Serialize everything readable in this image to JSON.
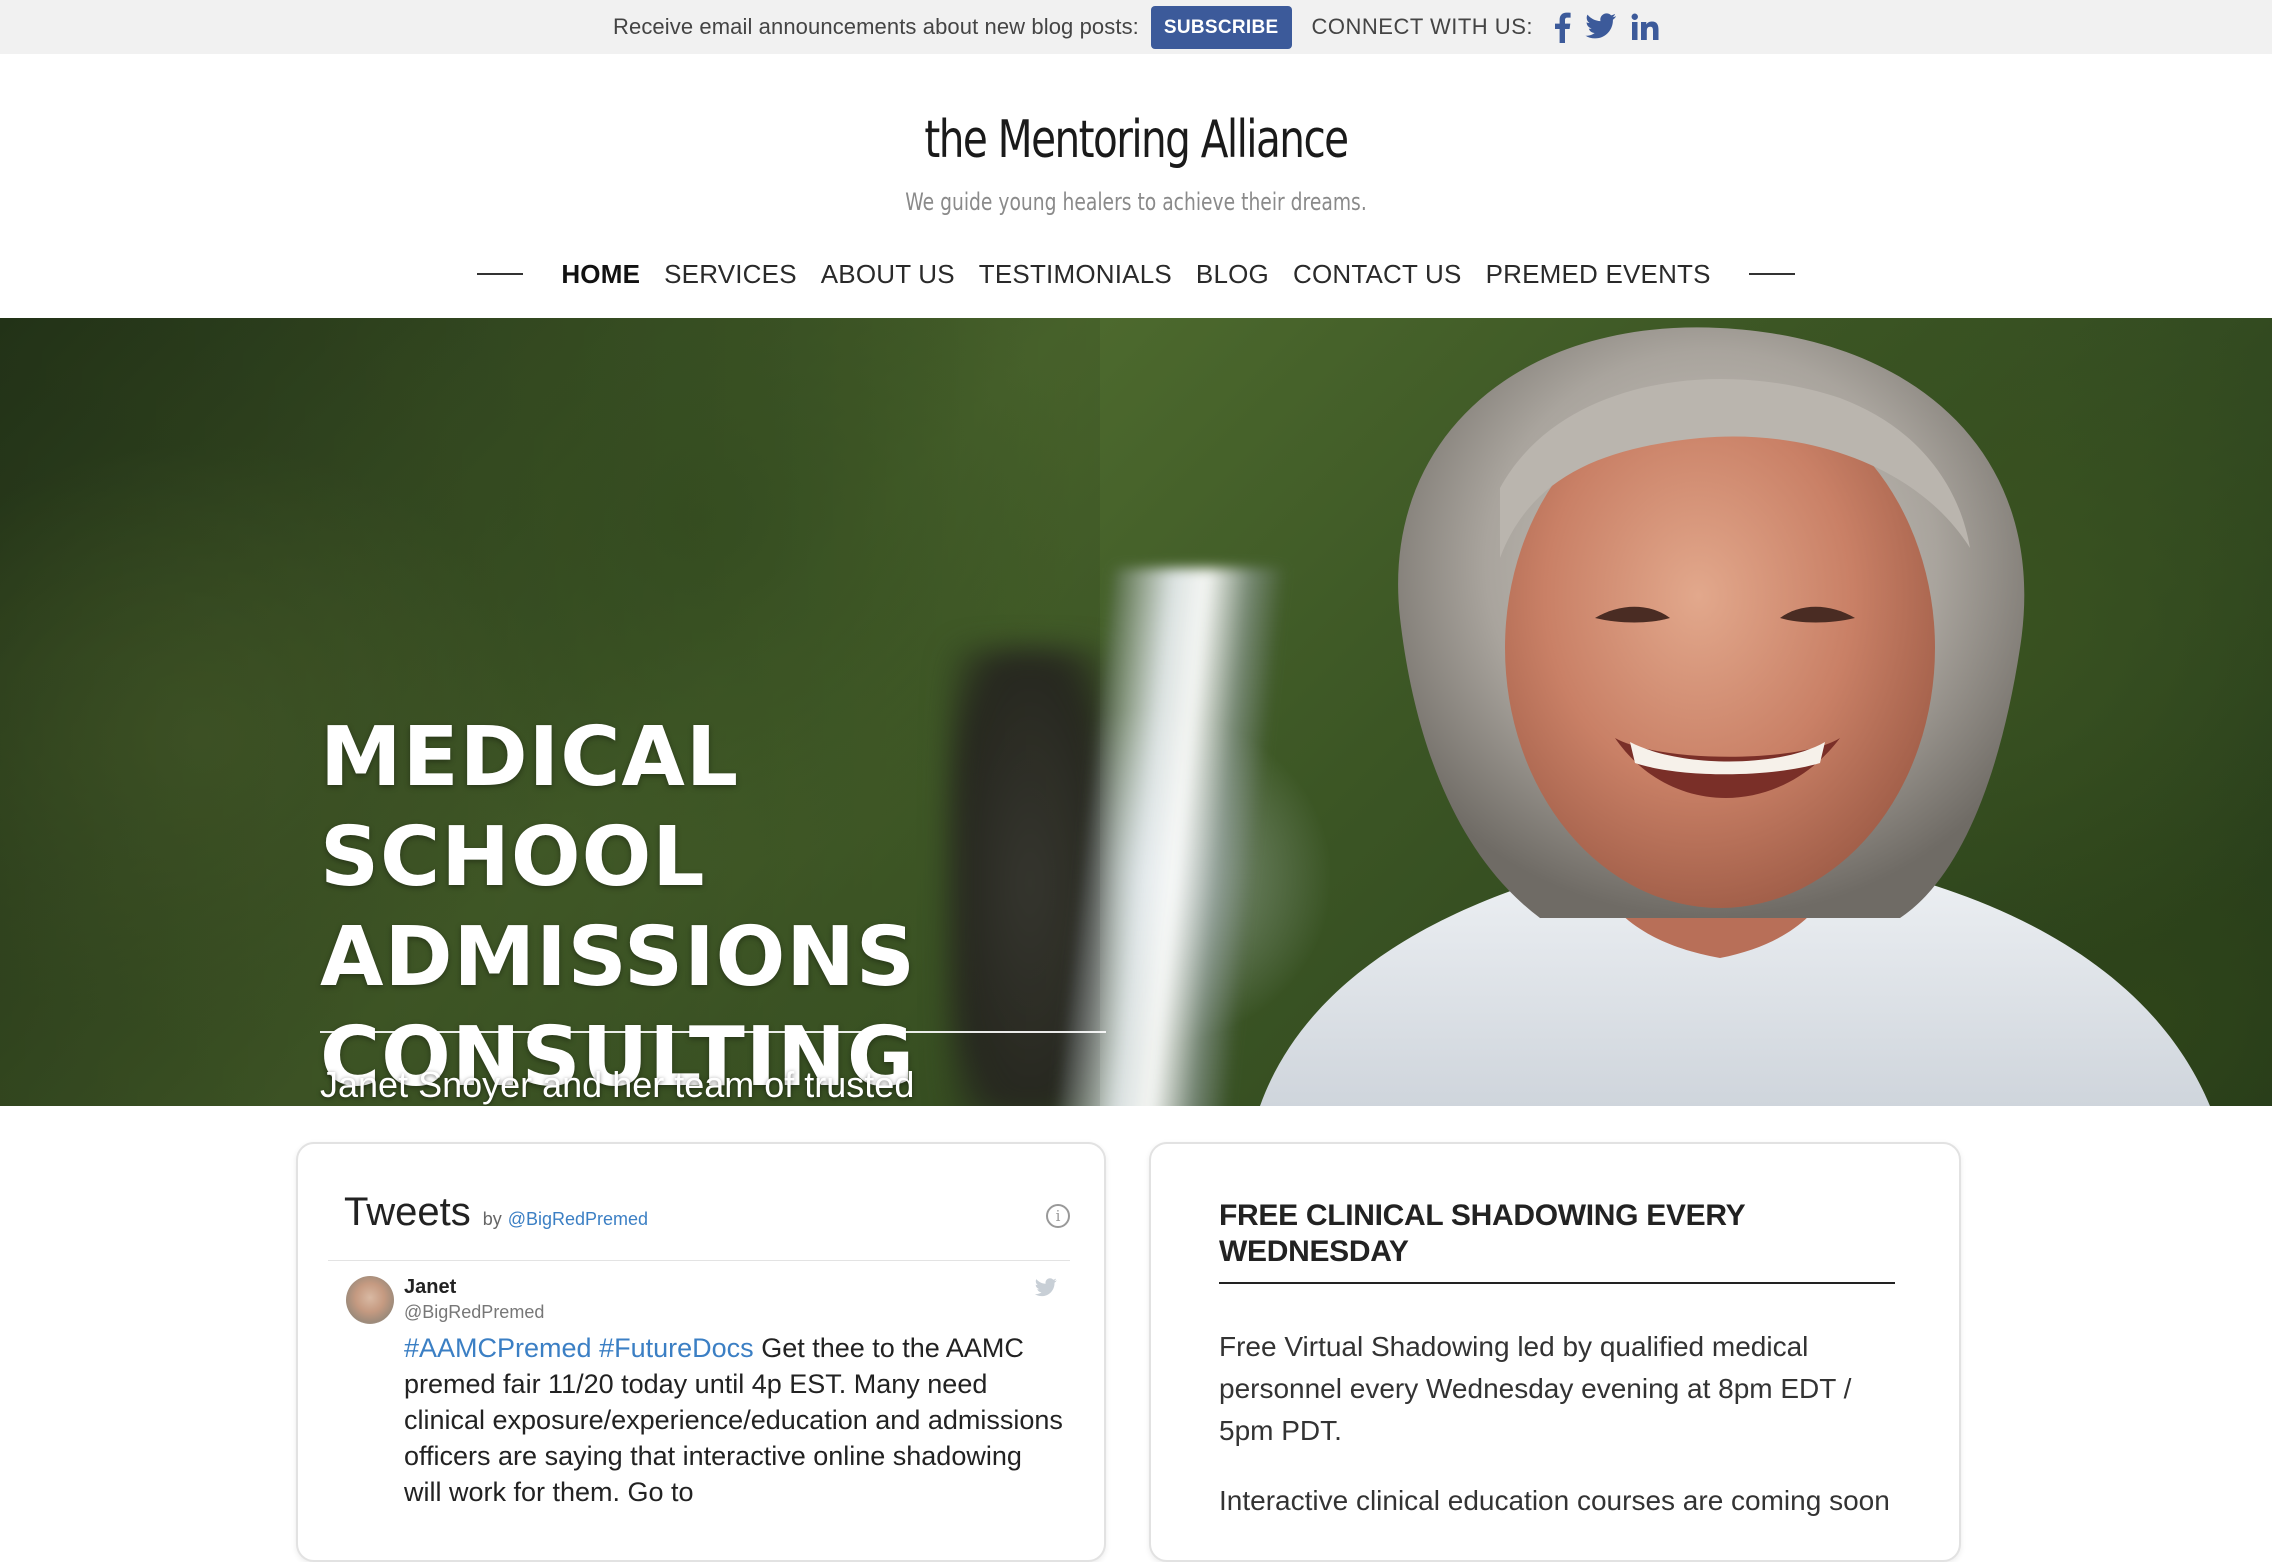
{
  "topbar": {
    "promo_text": "Receive email announcements about new blog posts:",
    "subscribe_label": "SUBSCRIBE",
    "connect_text": "CONNECT WITH US:",
    "social_icons": [
      "facebook-icon",
      "twitter-icon",
      "linkedin-icon"
    ],
    "subscribe_color": "#3c5a9a",
    "social_color": "#3c5a9a"
  },
  "header": {
    "site_title": "the Mentoring Alliance",
    "tagline": "We guide young healers to achieve their dreams."
  },
  "nav": {
    "items": [
      {
        "label": "HOME",
        "active": true
      },
      {
        "label": "SERVICES",
        "active": false
      },
      {
        "label": "ABOUT US",
        "active": false
      },
      {
        "label": "TESTIMONIALS",
        "active": false
      },
      {
        "label": "BLOG",
        "active": false
      },
      {
        "label": "CONTACT US",
        "active": false
      },
      {
        "label": "PREMED EVENTS",
        "active": false
      }
    ]
  },
  "hero": {
    "title_lines": [
      "MEDICAL SCHOOL",
      "ADMISSIONS",
      "CONSULTING"
    ],
    "description": "Janet Snoyer and her team of trusted advisors have guided thousands of passionate premeds to successful admission to medical, dental, and veterinary schools."
  },
  "tweets": {
    "title": "Tweets",
    "by": "by",
    "handle": "@BigRedPremed",
    "tweet": {
      "name": "Janet",
      "user": "@BigRedPremed",
      "hashtag1": "#AAMCPremed",
      "hashtag2": "#FutureDocs",
      "text": "Get thee to the AAMC premed fair 11/20 today until 4p EST.  Many need clinical exposure/experience/education and admissions officers are saying that interactive online shadowing will work for them. Go to"
    }
  },
  "shadowing": {
    "title": "FREE CLINICAL SHADOWING EVERY WEDNESDAY",
    "paragraph1": "Free Virtual Shadowing led by qualified medical personnel every Wednesday evening at 8pm EDT / 5pm PDT.",
    "paragraph2": "Interactive clinical education courses are coming soon"
  }
}
